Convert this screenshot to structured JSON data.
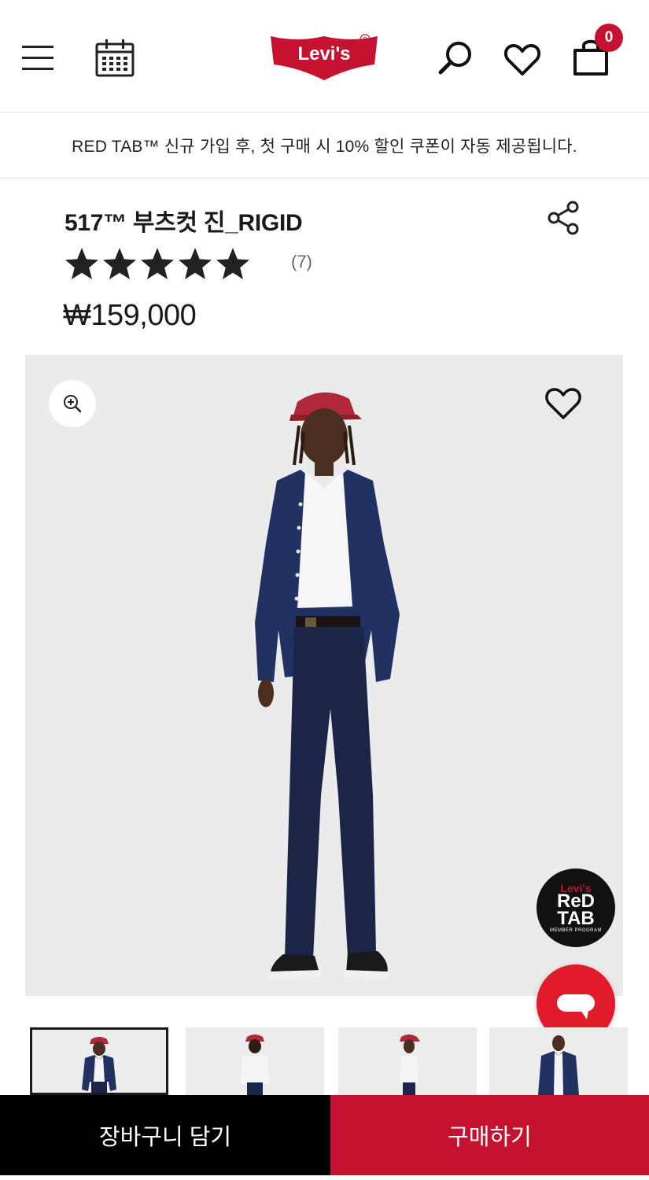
{
  "header": {
    "brand": "Levi's",
    "cart_count": "0"
  },
  "promo": {
    "text": "RED TAB™ 신규 가입 후, 첫 구매 시 10% 할인 쿠폰이 자동 제공됩니다."
  },
  "product": {
    "title": "517™ 부츠컷 진_RIGID",
    "rating_stars": 5,
    "review_count": "(7)",
    "price": "₩159,000"
  },
  "badge": {
    "brand": "Levi's",
    "line1": "ReD",
    "line2": "TAB",
    "sub": "MEMBER PROGRAM"
  },
  "colors": {
    "brand_red": "#c41230",
    "chat_red": "#e11b2c",
    "cart_button_bg": "#000000"
  },
  "icons": [
    "hamburger-menu-icon",
    "calendar-icon",
    "search-icon",
    "heart-icon",
    "shopping-bag-icon",
    "share-icon",
    "zoom-in-icon",
    "chat-icon"
  ],
  "thumbnails": [
    {
      "selected": true
    },
    {
      "selected": false
    },
    {
      "selected": false
    },
    {
      "selected": false
    }
  ],
  "actions": {
    "add_to_cart": "장바구니 담기",
    "buy_now": "구매하기"
  }
}
